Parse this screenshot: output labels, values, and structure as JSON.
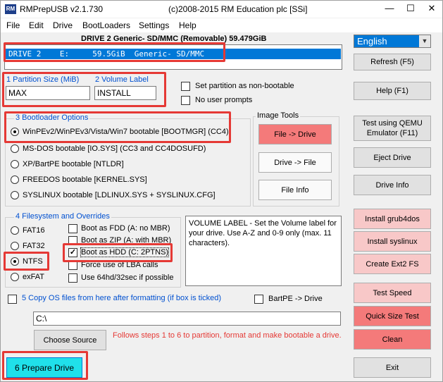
{
  "window": {
    "app_title": "RMPrepUSB v2.1.730",
    "copyright": "(c)2008-2015 RM Education plc [SSi]",
    "icon_text": "RM",
    "controls": [
      "—",
      "☐",
      "✕"
    ]
  },
  "menu": [
    "File",
    "Edit",
    "Drive",
    "BootLoaders",
    "Settings",
    "Help"
  ],
  "drive": {
    "header": "DRIVE 2 Generic- SD/MMC  (Removable) 59.479GiB",
    "row": "DRIVE 2    E:     59.5GiB  Generic- SD/MMC"
  },
  "language": "English",
  "partition": {
    "size_label": "1 Partition Size (MiB)",
    "size_value": "MAX",
    "volume_label": "2 Volume Label",
    "volume_value": "INSTALL",
    "nonbootable": "Set partition as non-bootable",
    "no_prompts": "No user prompts"
  },
  "bootloader": {
    "title": "3 Bootloader Options",
    "options": [
      "WinPEv2/WinPEv3/Vista/Win7 bootable [BOOTMGR] (CC4)",
      "MS-DOS bootable [IO.SYS]    (CC3 and CC4DOSUFD)",
      "XP/BartPE bootable [NTLDR]",
      "FREEDOS bootable [KERNEL.SYS]",
      "SYSLINUX bootable [LDLINUX.SYS + SYSLINUX.CFG]"
    ]
  },
  "image_tools": {
    "title": "Image Tools",
    "file_to_drive": "File -> Drive",
    "drive_to_file": "Drive -> File",
    "file_info": "File Info"
  },
  "filesystem": {
    "title": "4 Filesystem and Overrides",
    "types": [
      "FAT16",
      "FAT32",
      "NTFS",
      "exFAT"
    ],
    "overrides": [
      "Boot as FDD (A: no MBR)",
      "Boot as ZIP (A: with MBR)",
      "Boot as HDD (C: 2PTNS)",
      "Force use of LBA calls",
      "Use 64hd/32sec if possible"
    ]
  },
  "info_text": "VOLUME LABEL - Set the Volume label for your drive. Use A-Z and 0-9 only (max. 11 characters).",
  "copy": {
    "label": "5 Copy OS files from here after formatting (if box is ticked)",
    "bartpe": "BartPE -> Drive",
    "path": "C:\\"
  },
  "choose_source": "Choose Source",
  "footer_message": "Follows steps 1 to 6 to partition, format and make bootable a drive.",
  "prepare_drive": "6 Prepare Drive",
  "right_buttons": {
    "refresh": "Refresh (F5)",
    "help": "Help (F1)",
    "qemu": "Test using QEMU Emulator (F11)",
    "eject": "Eject Drive",
    "drive_info": "Drive Info",
    "grub4dos": "Install grub4dos",
    "syslinux": "Install syslinux",
    "ext2": "Create Ext2 FS",
    "test_speed": "Test Speed",
    "quick_size": "Quick Size Test",
    "clean": "Clean",
    "exit": "Exit"
  }
}
